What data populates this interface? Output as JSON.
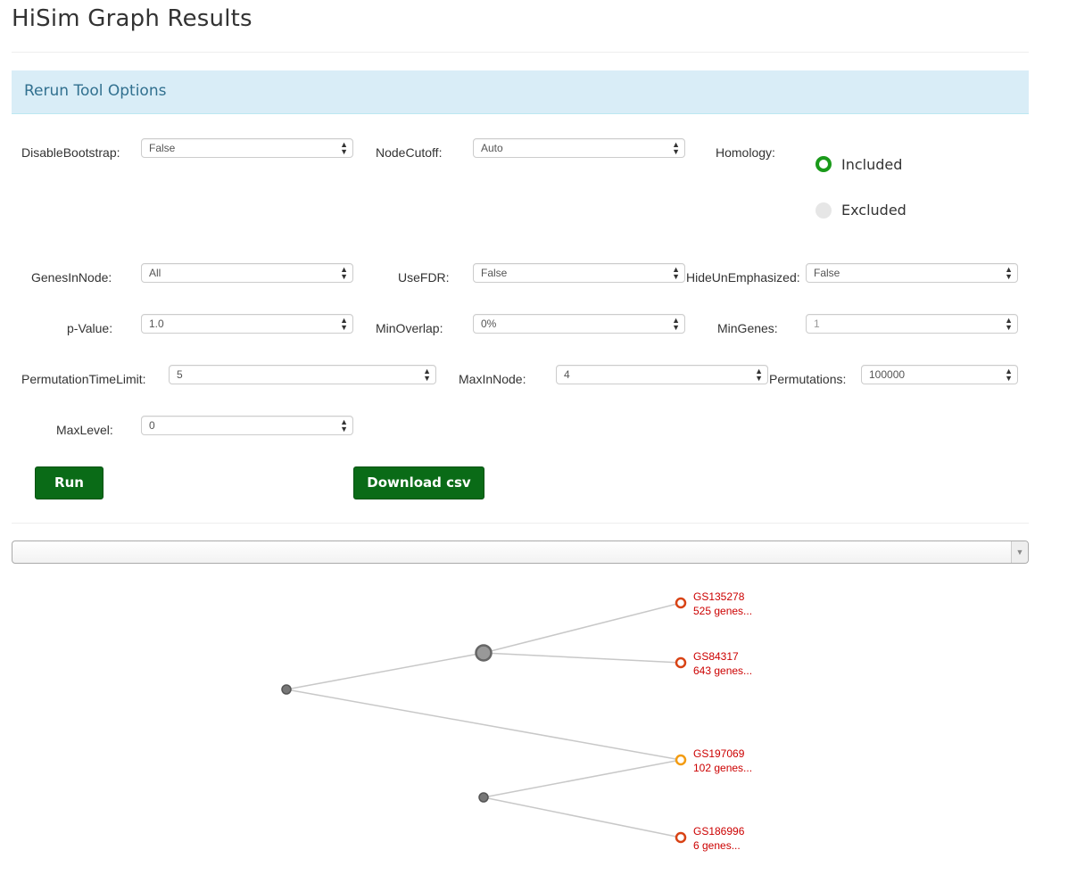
{
  "page": {
    "title": "HiSim Graph Results"
  },
  "panel": {
    "title": "Rerun Tool Options"
  },
  "options": {
    "disable_bootstrap": {
      "label": "DisableBootstrap:",
      "value": "False"
    },
    "node_cutoff": {
      "label": "NodeCutoff:",
      "value": "Auto"
    },
    "homology": {
      "label": "Homology:",
      "included": "Included",
      "excluded": "Excluded",
      "selected": "Included"
    },
    "genes_in_node": {
      "label": "GenesInNode:",
      "value": "All"
    },
    "use_fdr": {
      "label": "UseFDR:",
      "value": "False"
    },
    "hide_unemphasized": {
      "label": "HideUnEmphasized:",
      "value": "False"
    },
    "p_value": {
      "label": "p-Value:",
      "value": "1.0"
    },
    "min_overlap": {
      "label": "MinOverlap:",
      "value": "0%"
    },
    "min_genes": {
      "label": "MinGenes:",
      "value": "1"
    },
    "permutation_time_limit": {
      "label": "PermutationTimeLimit:",
      "value": "5"
    },
    "max_in_node": {
      "label": "MaxInNode:",
      "value": "4"
    },
    "permutations": {
      "label": "Permutations:",
      "value": "100000"
    },
    "max_level": {
      "label": "MaxLevel:",
      "value": "0"
    }
  },
  "buttons": {
    "run": "Run",
    "download": "Download csv"
  },
  "selector": {
    "value": ""
  },
  "tree": {
    "leaves": [
      {
        "id": "GS135278",
        "genes": "525 genes...",
        "color": "#d84315"
      },
      {
        "id": "GS84317",
        "genes": "643 genes...",
        "color": "#d84315"
      },
      {
        "id": "GS197069",
        "genes": "102 genes...",
        "color": "#f39c12"
      },
      {
        "id": "GS186996",
        "genes": "6 genes...",
        "color": "#d84315"
      }
    ],
    "colors": {
      "edge": "#c8c8c8",
      "inner_node": "#777777",
      "label": "#cc0000"
    }
  }
}
